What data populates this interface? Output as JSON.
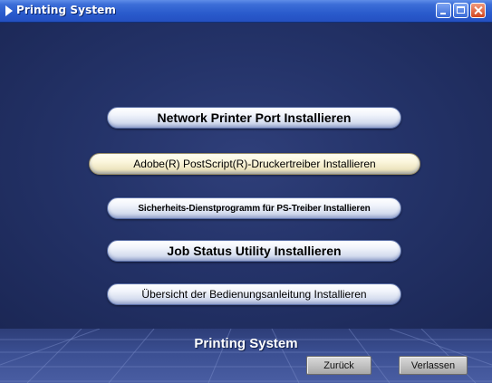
{
  "window": {
    "title": "Printing System",
    "controls": [
      "minimize-icon",
      "maximize-icon",
      "close-icon"
    ]
  },
  "menu": {
    "items": [
      {
        "label": "Network Printer Port Installieren"
      },
      {
        "label": "Adobe(R) PostScript(R)-Druckertreiber Installieren"
      },
      {
        "label": "Sicherheits-Dienstprogramm für PS-Treiber Installieren"
      },
      {
        "label": "Job Status Utility Installieren"
      },
      {
        "label": "Übersicht der Bedienungsanleitung Installieren"
      }
    ]
  },
  "footer": {
    "title": "Printing System",
    "back_label": "Zurück",
    "exit_label": "Verlassen"
  },
  "colors": {
    "title_bar": "#2a5bcc",
    "background": "#243369",
    "highlight_button": "#fbf6dc"
  }
}
